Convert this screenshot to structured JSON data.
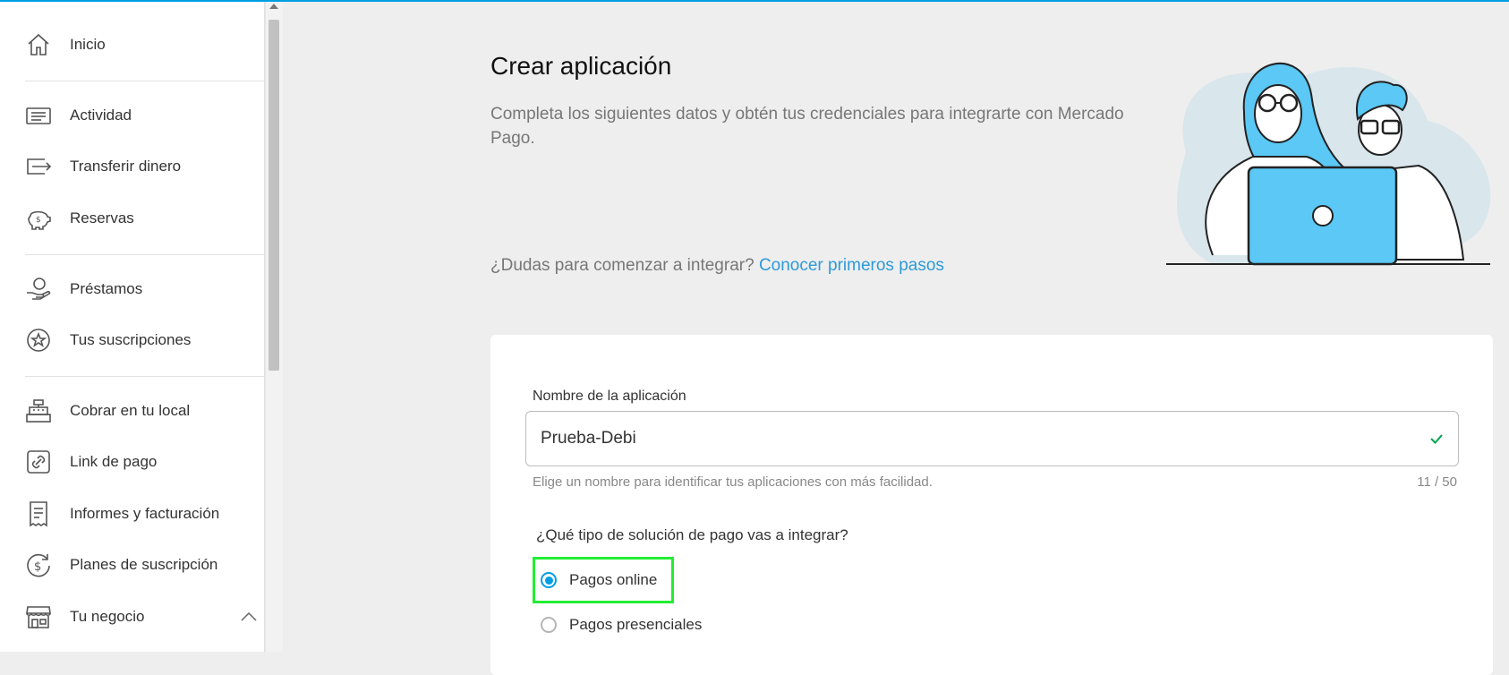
{
  "colors": {
    "accent": "#009ee3",
    "link": "#2d9ad8",
    "success": "#00a650",
    "highlight": "#22ee33",
    "illustration": "#5bc8f5"
  },
  "sidebar": {
    "items": [
      {
        "label": "Inicio",
        "icon": "home-icon"
      },
      {
        "label": "Actividad",
        "icon": "activity-icon"
      },
      {
        "label": "Transferir dinero",
        "icon": "transfer-icon"
      },
      {
        "label": "Reservas",
        "icon": "piggy-bank-icon"
      },
      {
        "label": "Préstamos",
        "icon": "loan-hand-icon"
      },
      {
        "label": "Tus suscripciones",
        "icon": "star-badge-icon"
      },
      {
        "label": "Cobrar en tu local",
        "icon": "cash-register-icon"
      },
      {
        "label": "Link de pago",
        "icon": "link-icon"
      },
      {
        "label": "Informes y facturación",
        "icon": "receipt-icon"
      },
      {
        "label": "Planes de suscripción",
        "icon": "dollar-refresh-icon"
      },
      {
        "label": "Tu negocio",
        "icon": "store-icon",
        "expanded": true
      }
    ]
  },
  "main": {
    "title": "Crear aplicación",
    "subtitle": "Completa los siguientes datos y obtén tus credenciales para integrarte con Mercado Pago.",
    "help_text": "¿Dudas para comenzar a integrar?",
    "help_link": "Conocer primeros pasos"
  },
  "form": {
    "name_label": "Nombre de la aplicación",
    "name_value": "Prueba-Debi",
    "name_hint": "Elige un nombre para identificar tus aplicaciones con más facilidad.",
    "name_counter": "11 / 50",
    "question": "¿Qué tipo de solución de pago vas a integrar?",
    "options": [
      {
        "label": "Pagos online",
        "selected": true
      },
      {
        "label": "Pagos presenciales",
        "selected": false
      }
    ]
  }
}
